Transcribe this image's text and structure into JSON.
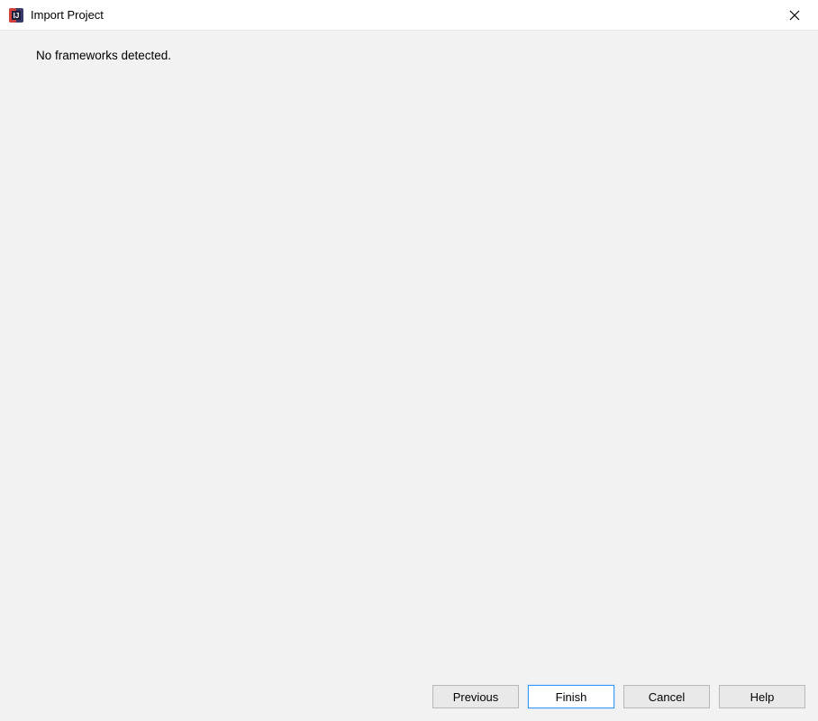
{
  "titlebar": {
    "title": "Import Project"
  },
  "content": {
    "message": "No frameworks detected."
  },
  "buttons": {
    "previous": "Previous",
    "finish": "Finish",
    "cancel": "Cancel",
    "help": "Help"
  }
}
